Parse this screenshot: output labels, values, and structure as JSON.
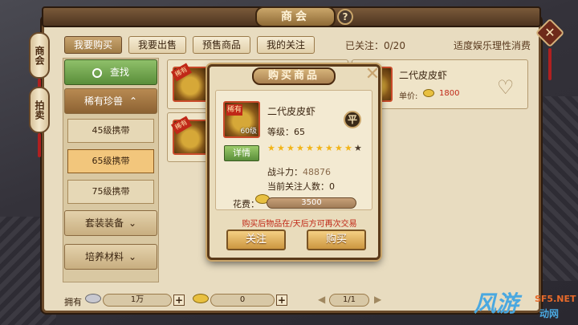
{
  "window": {
    "title": "商会",
    "help_label": "?",
    "close_label": "✕"
  },
  "side_tabs": [
    "商会",
    "拍卖"
  ],
  "tabs": [
    {
      "label": "我要购买",
      "active": true
    },
    {
      "label": "我要出售",
      "active": false
    },
    {
      "label": "预售商品",
      "active": false
    },
    {
      "label": "我的关注",
      "active": false
    }
  ],
  "followed": "已关注：0/20",
  "slogan": "适度娱乐理性消费",
  "nav": {
    "search": "查找",
    "rare": "稀有珍兽",
    "subs": [
      {
        "label": "45级携带",
        "active": false
      },
      {
        "label": "65级携带",
        "active": true
      },
      {
        "label": "75级携带",
        "active": false
      }
    ],
    "sets": "套装装备",
    "materials": "培养材料"
  },
  "list_card": {
    "ribbon": "稀有",
    "name": "二代皮皮虾",
    "price_label": "单价:",
    "price": "1800"
  },
  "bottom": {
    "own_label": "拥有",
    "silver": "1万",
    "gold": "0",
    "page": "1/1",
    "plus": "+"
  },
  "dialog": {
    "title": "购买商品",
    "close": "✕",
    "ribbon": "稀有",
    "level_badge": "60级",
    "name": "二代皮皮虾",
    "grade_label": "等级：",
    "grade": "65",
    "flat_badge": "平",
    "detail": "详情",
    "stars_on": 9,
    "stars_total": 10,
    "power_label": "战斗力：",
    "power": "48876",
    "followers_label": "当前关注人数：",
    "followers": "0",
    "cost_label": "花费：",
    "cost": "3500",
    "warning": "购买后物品在/天后方可再次交易",
    "follow_btn": "关注",
    "buy_btn": "购买"
  },
  "watermark": {
    "main": "风游",
    "sub": "SF5.NET",
    "tag": "动网"
  },
  "colors": {
    "accent_red": "#c02818",
    "gold": "#f2b418",
    "green": "#5a8e3a"
  }
}
